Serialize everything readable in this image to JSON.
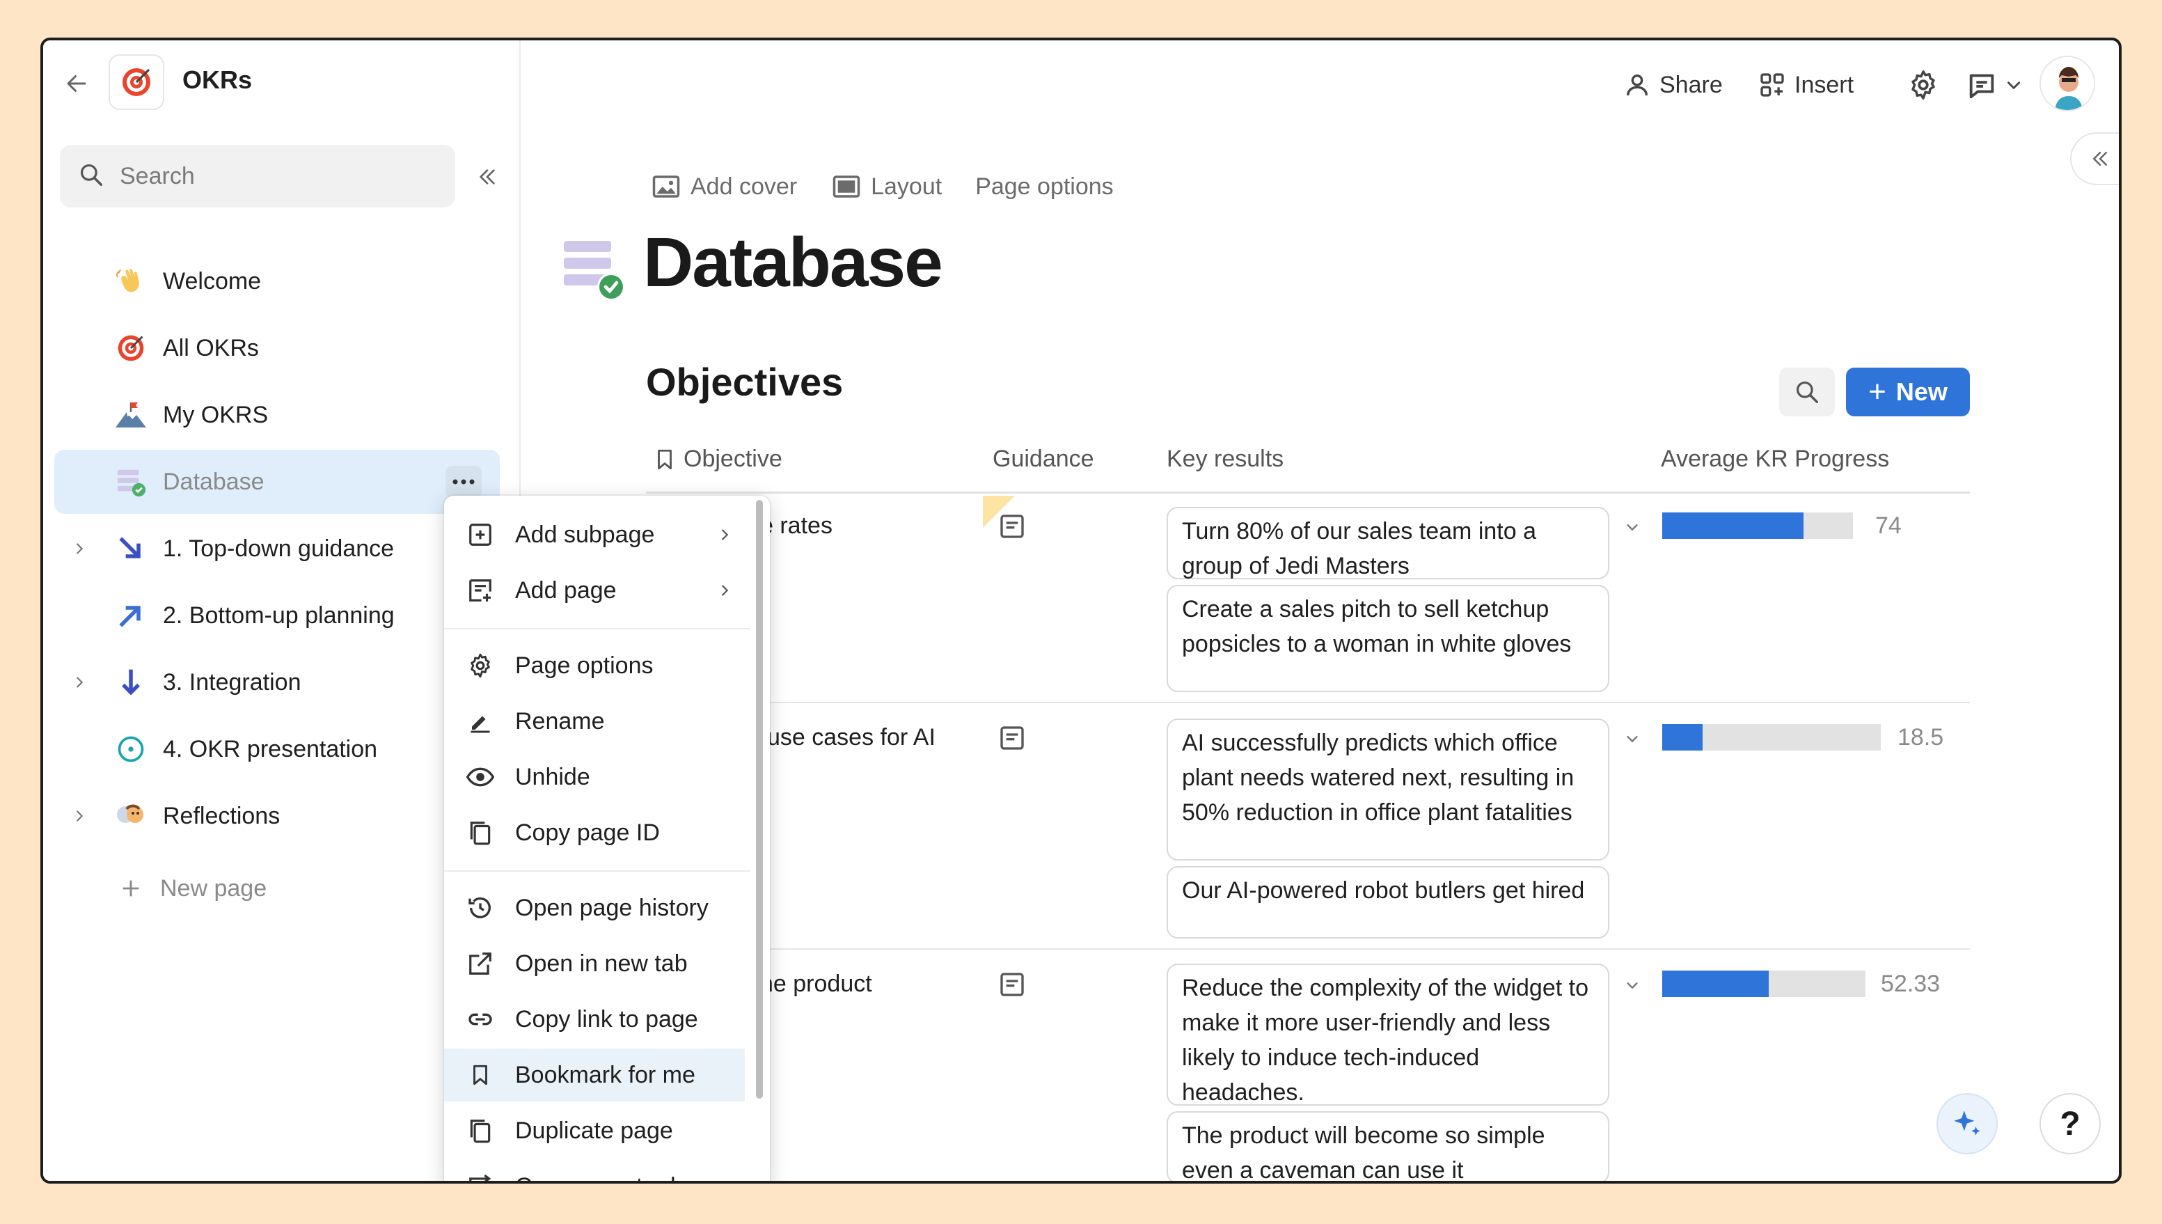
{
  "sidebar": {
    "app_title": "OKRs",
    "search_placeholder": "Search",
    "items": [
      {
        "label": "Welcome",
        "icon": "waving-hand-icon"
      },
      {
        "label": "All OKRs",
        "icon": "target-icon"
      },
      {
        "label": "My OKRS",
        "icon": "mountain-flag-icon"
      },
      {
        "label": "Database",
        "icon": "database-check-icon"
      },
      {
        "label": "1. Top-down guidance",
        "icon": "arrow-down-right-icon"
      },
      {
        "label": "2. Bottom-up planning",
        "icon": "arrow-up-right-icon"
      },
      {
        "label": "3. Integration",
        "icon": "arrow-down-icon"
      },
      {
        "label": "4. OKR presentation",
        "icon": "circle-target-icon"
      },
      {
        "label": "Reflections",
        "icon": "people-icon"
      }
    ],
    "new_page_label": "New page"
  },
  "context_menu": {
    "items": [
      {
        "label": "Add subpage"
      },
      {
        "label": "Add page"
      },
      {
        "label": "Page options"
      },
      {
        "label": "Rename"
      },
      {
        "label": "Unhide"
      },
      {
        "label": "Copy page ID"
      },
      {
        "label": "Open page history"
      },
      {
        "label": "Open in new tab"
      },
      {
        "label": "Copy link to page"
      },
      {
        "label": "Bookmark for me"
      },
      {
        "label": "Duplicate page"
      },
      {
        "label": "Copy page to doc"
      }
    ]
  },
  "topbar": {
    "share_label": "Share",
    "insert_label": "Insert"
  },
  "page": {
    "add_cover_label": "Add cover",
    "layout_label": "Layout",
    "page_options_label": "Page options",
    "title": "Database",
    "section_title": "Objectives",
    "new_button_label": "New"
  },
  "table": {
    "headers": {
      "objective": "Objective",
      "guidance": "Guidance",
      "key_results": "Key results",
      "progress": "Average KR Progress"
    },
    "rows": [
      {
        "objective": "e rates",
        "key_results": [
          "Turn 80% of our sales team into a group of Jedi Masters",
          "Create a sales pitch to sell ketchup popsicles to a woman in white gloves"
        ],
        "progress": 74,
        "progress_label": "74"
      },
      {
        "objective": "use cases for AI",
        "key_results": [
          "AI successfully predicts which office plant needs watered next, resulting in 50% reduction in office plant fatalities",
          "Our AI-powered robot butlers get hired"
        ],
        "progress": 18.5,
        "progress_label": "18.5"
      },
      {
        "objective": "he product",
        "key_results": [
          "Reduce the complexity of the widget to make it more user-friendly and less likely to induce tech-induced headaches.",
          "The product will become so simple even a caveman can use it"
        ],
        "progress": 52.33,
        "progress_label": "52.33"
      }
    ]
  },
  "help_label": "?",
  "colors": {
    "accent": "#2f74d8",
    "background": "#fde5c6",
    "active_item": "#e0eefb"
  }
}
